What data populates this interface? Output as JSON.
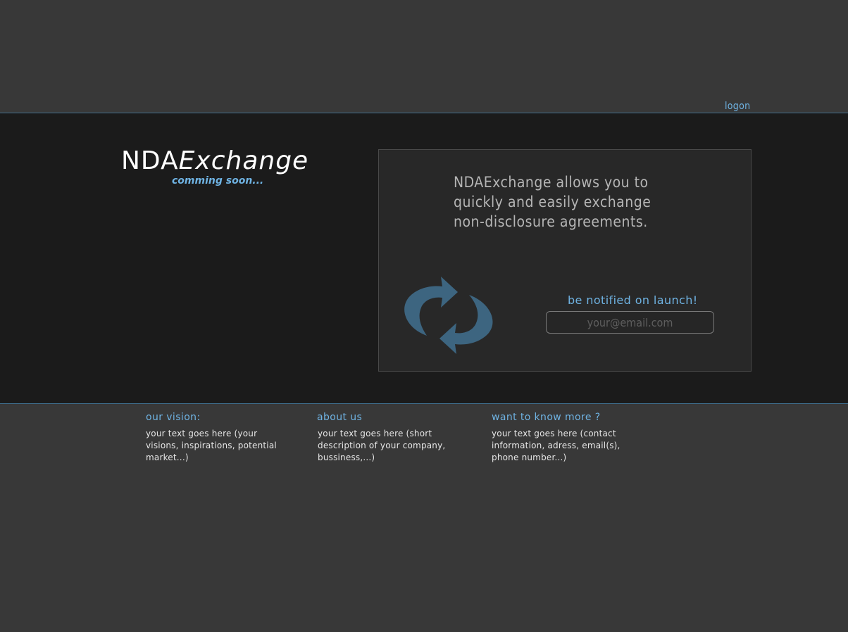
{
  "header": {
    "logon_label": "logon"
  },
  "logo": {
    "prefix": "NDA",
    "suffix": "Exchange",
    "tagline": "comming soon..."
  },
  "panel": {
    "headline": "NDAExchange allows you to quickly and easily exchange non-disclosure agreements.",
    "notify_label": "be notified on launch!",
    "email_placeholder": "your@email.com",
    "icon": "sync-arrows-icon"
  },
  "footer": {
    "vision": {
      "title": "our vision:",
      "text": "your text goes here (your visions, inspirations, potential market...)"
    },
    "about": {
      "title": "about us",
      "text": "your text goes here (short description of your company, bussiness,...)"
    },
    "more": {
      "title": "want to know more ?",
      "text": "your text goes here (contact information, adress, email(s), phone number...)"
    }
  },
  "colors": {
    "accent": "#6fb3e3",
    "background": "#383838",
    "band": "#1b1b1b",
    "panel": "#282828",
    "icon": "#3d6580"
  }
}
